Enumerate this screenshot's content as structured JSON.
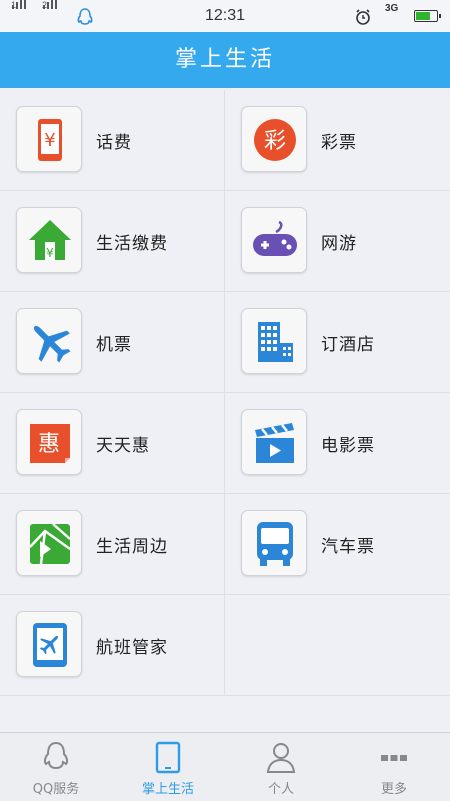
{
  "status_bar": {
    "time": "12:31",
    "signal1": "1",
    "signal2": "2",
    "network": "3G",
    "icons": [
      "signal-icon",
      "signal-icon",
      "qq-penguin-icon",
      "alarm-icon",
      "battery-icon"
    ]
  },
  "header": {
    "title": "掌上生活"
  },
  "grid": [
    {
      "label": "话费",
      "icon": "phone-bill-icon",
      "color": "#e8502c"
    },
    {
      "label": "彩票",
      "icon": "lottery-icon",
      "color": "#e8502c"
    },
    {
      "label": "生活缴费",
      "icon": "house-yen-icon",
      "color": "#3aa935"
    },
    {
      "label": "网游",
      "icon": "gamepad-icon",
      "color": "#6a4fb5"
    },
    {
      "label": "机票",
      "icon": "airplane-icon",
      "color": "#2b86d8"
    },
    {
      "label": "订酒店",
      "icon": "hotel-icon",
      "color": "#2b86d8"
    },
    {
      "label": "天天惠",
      "icon": "tiantianhui-icon",
      "color": "#e8502c"
    },
    {
      "label": "电影票",
      "icon": "clapperboard-icon",
      "color": "#2b86d8"
    },
    {
      "label": "生活周边",
      "icon": "map-icon",
      "color": "#3aa935"
    },
    {
      "label": "汽车票",
      "icon": "bus-icon",
      "color": "#2b86d8"
    },
    {
      "label": "航班管家",
      "icon": "flight-tablet-icon",
      "color": "#2b86d8"
    }
  ],
  "bottom_nav": [
    {
      "label": "QQ服务",
      "icon": "qq-penguin-icon",
      "active": false
    },
    {
      "label": "掌上生活",
      "icon": "tablet-icon",
      "active": true
    },
    {
      "label": "个人",
      "icon": "person-icon",
      "active": false
    },
    {
      "label": "更多",
      "icon": "more-dots-icon",
      "active": false
    }
  ],
  "colors": {
    "header": "#34a9ee",
    "active_tab": "#2e9be4"
  }
}
